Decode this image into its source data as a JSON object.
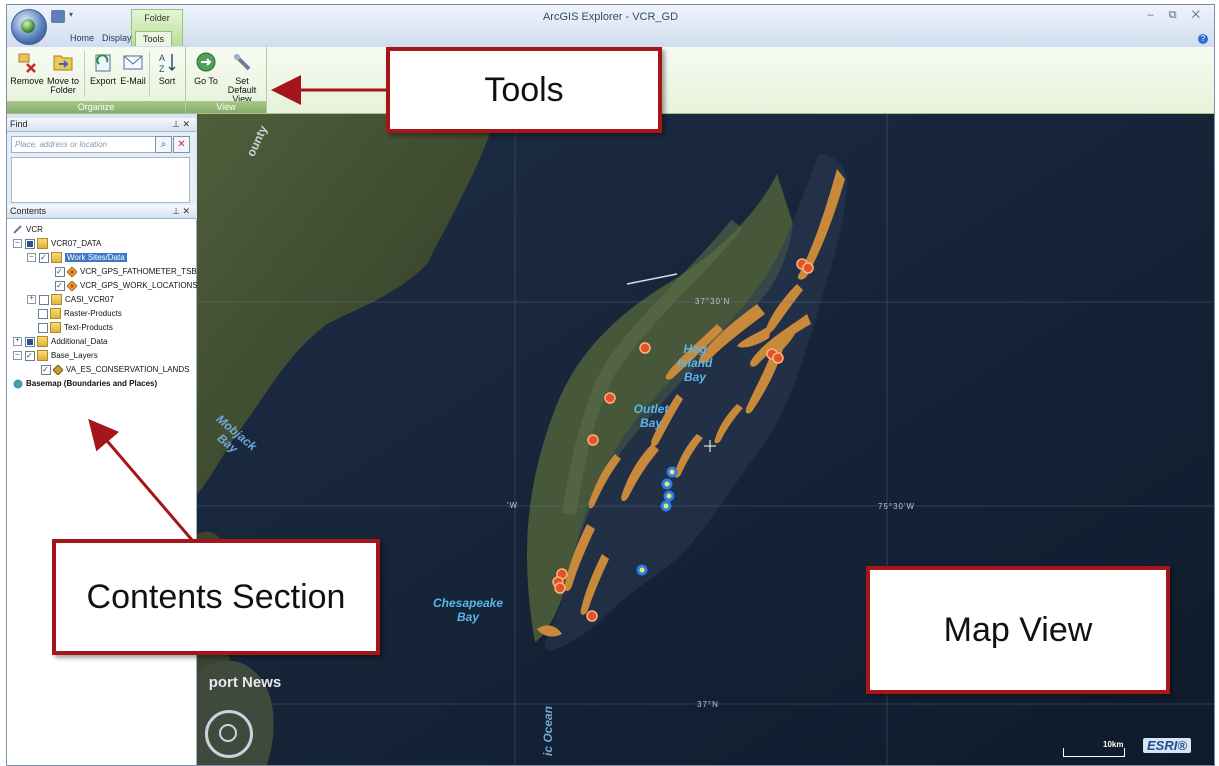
{
  "window": {
    "title": "ArcGIS Explorer - VCR_GD",
    "controls": "– ⧉ ✕",
    "context_group": "Folder",
    "tabs": [
      "Home",
      "Display",
      "Tools"
    ],
    "active_tab": "Tools"
  },
  "ribbon": {
    "groups": [
      {
        "label": "Organize",
        "buttons": [
          {
            "label": "Remove",
            "icon": "remove-icon"
          },
          {
            "label": "Move to Folder",
            "icon": "folder-move-icon"
          },
          {
            "label": "Export",
            "icon": "export-icon"
          },
          {
            "label": "E-Mail",
            "icon": "email-icon"
          },
          {
            "label": "Sort",
            "icon": "sort-az-icon"
          }
        ]
      },
      {
        "label": "View",
        "buttons": [
          {
            "label": "Go To",
            "icon": "goto-icon"
          },
          {
            "label": "Set Default View",
            "icon": "set-default-view-icon"
          }
        ]
      }
    ]
  },
  "find": {
    "title": "Find",
    "placeholder": "Place, address or location",
    "pin": "⊥ ✕"
  },
  "contents": {
    "title": "Contents",
    "pin": "⊥ ✕",
    "items": [
      {
        "label": "VCR",
        "level": 0
      },
      {
        "label": "VCR07_DATA",
        "level": 0
      },
      {
        "label": "Work Sites/Data",
        "level": 1,
        "selected": true
      },
      {
        "label": "VCR_GPS_FATHOMETER_TSB",
        "level": 2
      },
      {
        "label": "VCR_GPS_WORK_LOCATIONS",
        "level": 2
      },
      {
        "label": "CASI_VCR07",
        "level": 1
      },
      {
        "label": "Raster-Products",
        "level": 1
      },
      {
        "label": "Text-Products",
        "level": 1
      },
      {
        "label": "Additional_Data",
        "level": 0
      },
      {
        "label": "Base_Layers",
        "level": 0
      },
      {
        "label": "VA_ES_CONSERVATION_LANDS",
        "level": 1
      },
      {
        "label": "Basemap (Boundaries and Places)",
        "level": 0
      }
    ]
  },
  "map": {
    "labels": {
      "hog_island_bay": "Hog Island Bay",
      "outlet_bay": "Outlet Bay",
      "chesapeake_bay": "Chesapeake Bay",
      "mobjack_bay": "Mobjack Bay",
      "port_news": "port News",
      "county": "ounty",
      "ocean": "ic Ocean"
    },
    "coords": {
      "lat_37_30": "37°30'N",
      "lon_75_30": "75°30'W",
      "lat_37": "37°N",
      "w_label": "'W"
    },
    "scale": "10km",
    "logo": "ESRI®"
  },
  "callouts": {
    "tools": "Tools",
    "contents": "Contents Section",
    "map_view": "Map View"
  },
  "colors": {
    "callout_border": "#a4161a",
    "wetland": "#c8893a",
    "water_label": "#58b6ea"
  }
}
